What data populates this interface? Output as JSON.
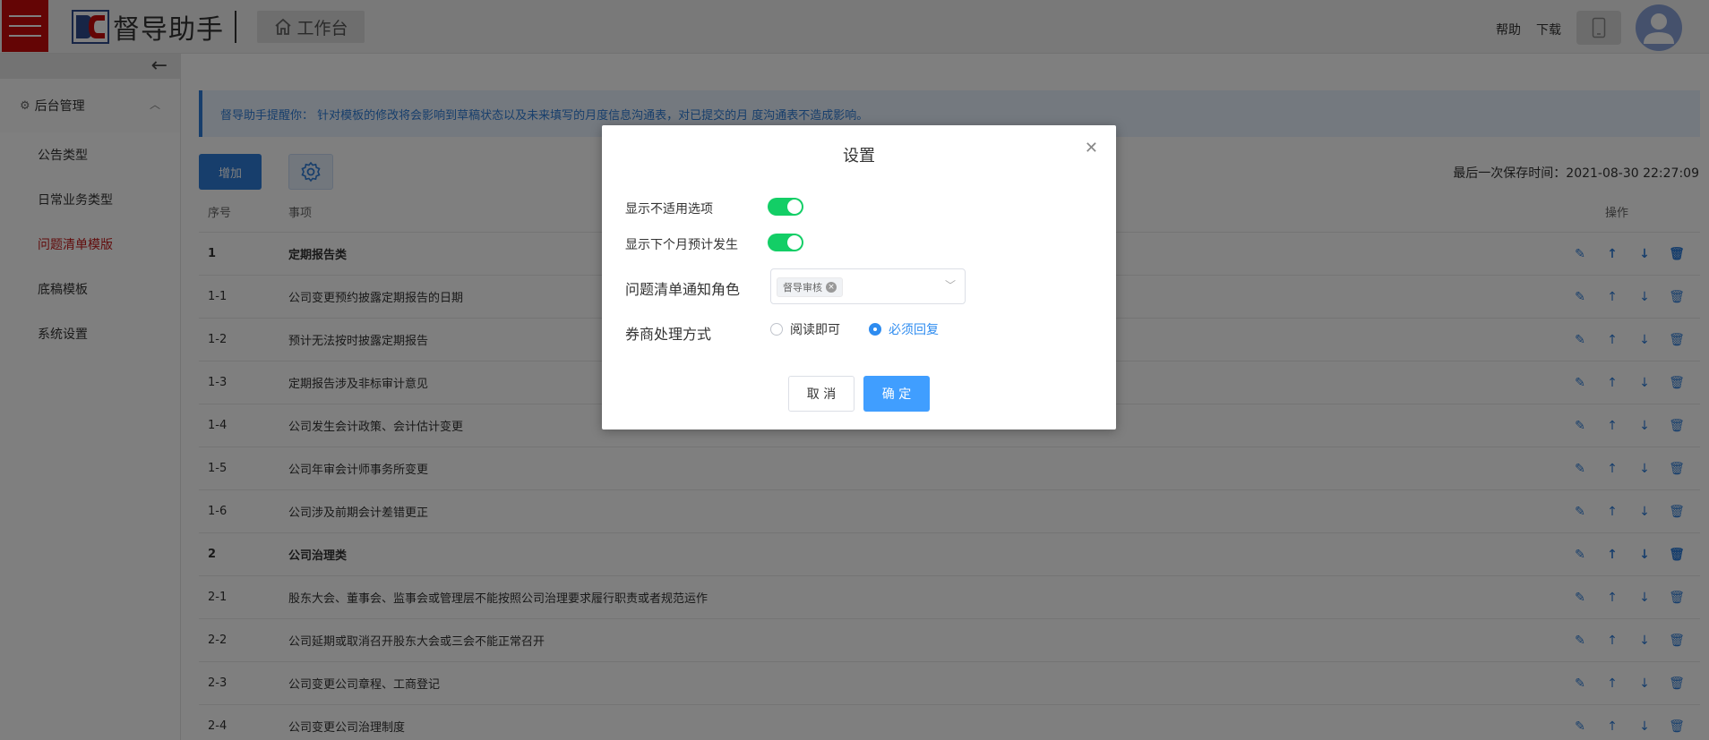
{
  "header": {
    "app_name": "督导助手",
    "workbench_label": "工作台",
    "help_label": "帮助",
    "download_label": "下载"
  },
  "sidebar": {
    "group_label": "后台管理",
    "items": [
      {
        "label": "公告类型",
        "active": false
      },
      {
        "label": "日常业务类型",
        "active": false
      },
      {
        "label": "问题清单模版",
        "active": true
      },
      {
        "label": "底稿模板",
        "active": false
      },
      {
        "label": "系统设置",
        "active": false
      }
    ]
  },
  "main": {
    "notice": "督导助手提醒你：  针对模板的修改将会影响到草稿状态以及未来填写的月度信息沟通表，对已提交的月 度沟通表不造成影响。",
    "add_label": "增加",
    "last_saved": "最后一次保存时间：2021-08-30 22:27:09",
    "columns": {
      "no": "序号",
      "item": "事项",
      "ops": "操作"
    },
    "rows": [
      {
        "no": "1",
        "item": "定期报告类",
        "bold": true
      },
      {
        "no": "1-1",
        "item": "公司变更预约披露定期报告的日期",
        "bold": false
      },
      {
        "no": "1-2",
        "item": "预计无法按时披露定期报告",
        "bold": false
      },
      {
        "no": "1-3",
        "item": "定期报告涉及非标审计意见",
        "bold": false
      },
      {
        "no": "1-4",
        "item": "公司发生会计政策、会计估计变更",
        "bold": false
      },
      {
        "no": "1-5",
        "item": "公司年审会计师事务所变更",
        "bold": false
      },
      {
        "no": "1-6",
        "item": "公司涉及前期会计差错更正",
        "bold": false
      },
      {
        "no": "2",
        "item": "公司治理类",
        "bold": true
      },
      {
        "no": "2-1",
        "item": "股东大会、董事会、监事会或管理层不能按照公司治理要求履行职责或者规范运作",
        "bold": false
      },
      {
        "no": "2-2",
        "item": "公司延期或取消召开股东大会或三会不能正常召开",
        "bold": false
      },
      {
        "no": "2-3",
        "item": "公司变更公司章程、工商登记",
        "bold": false
      },
      {
        "no": "2-4",
        "item": "公司变更公司治理制度",
        "bold": false
      }
    ]
  },
  "modal": {
    "title": "设置",
    "toggle1_label": "显示不适用选项",
    "toggle1_on": true,
    "toggle2_label": "显示下个月预计发生",
    "toggle2_on": true,
    "role_label": "问题清单通知角色",
    "role_tag": "督导审核",
    "handling_label": "券商处理方式",
    "options": [
      {
        "label": "阅读即可",
        "checked": false
      },
      {
        "label": "必须回复",
        "checked": true
      }
    ],
    "cancel_label": "取 消",
    "ok_label": "确 定"
  },
  "colors": {
    "brand_red": "#c80a0a",
    "primary_blue": "#2e7dd8",
    "switch_green": "#13ce66",
    "active_nav": "#c41a1a"
  }
}
